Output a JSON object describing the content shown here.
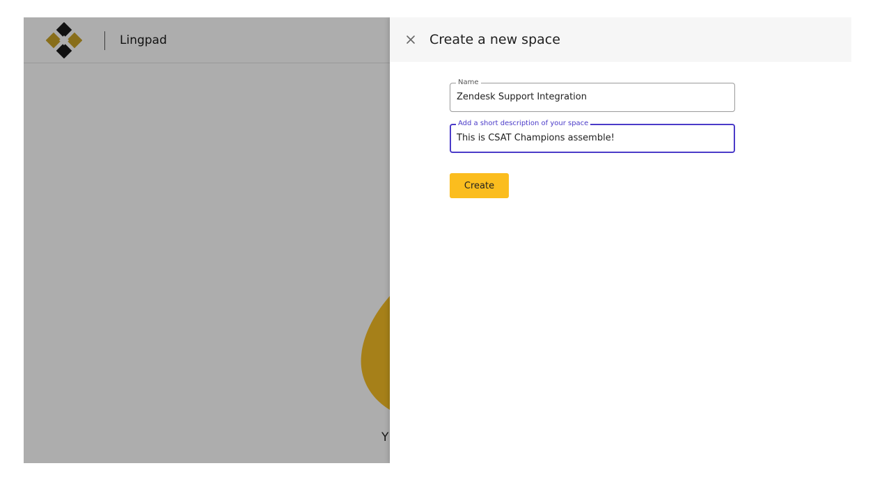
{
  "app": {
    "title": "Lingpad",
    "brand_colors": {
      "gold": "#c9a227",
      "black": "#1a1a1a"
    }
  },
  "background": {
    "empty_state_text": "Y"
  },
  "drawer": {
    "title": "Create a new space",
    "close_icon": "close-icon",
    "name_field": {
      "label": "Name",
      "value": "Zendesk Support Integration"
    },
    "description_field": {
      "label": "Add a short description of your space",
      "value": "This is CSAT Champions assemble!"
    },
    "create_label": "Create",
    "accent_color": "#4a3ac8",
    "button_color": "#fbbd1e"
  }
}
